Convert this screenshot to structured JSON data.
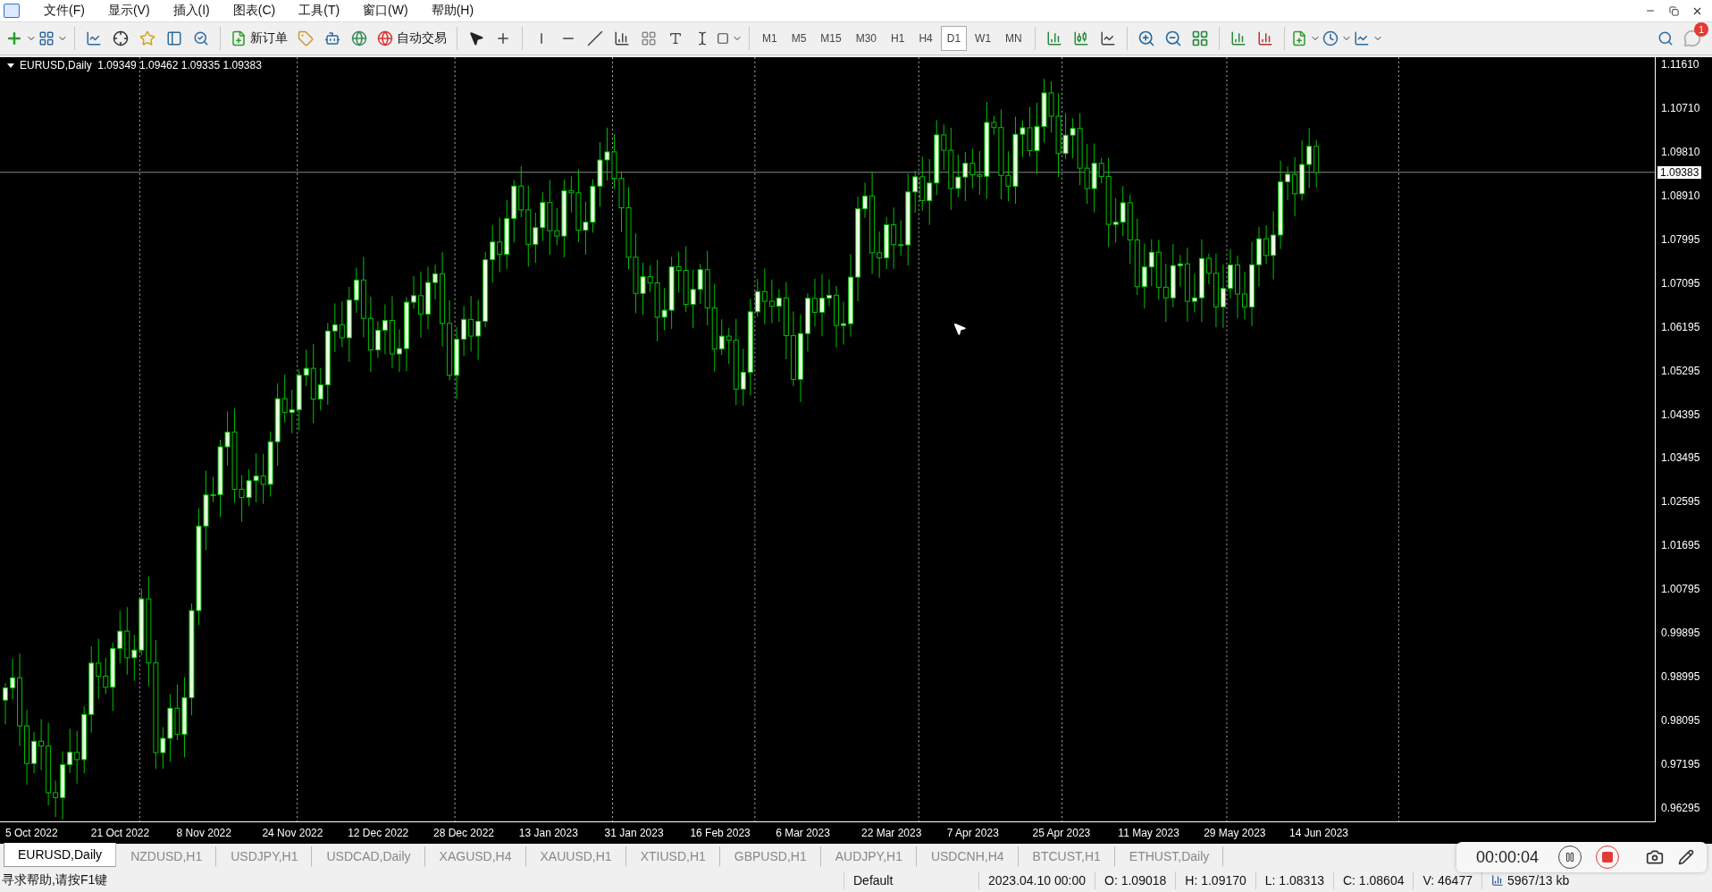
{
  "menu": [
    {
      "label": "文件(F)"
    },
    {
      "label": "显示(V)"
    },
    {
      "label": "插入(I)"
    },
    {
      "label": "图表(C)"
    },
    {
      "label": "工具(T)"
    },
    {
      "label": "窗口(W)"
    },
    {
      "label": "帮助(H)"
    }
  ],
  "toolbar": {
    "new_order": "新订单",
    "auto_trading": "自动交易",
    "timeframes": [
      {
        "label": "M1",
        "selected": false
      },
      {
        "label": "M5",
        "selected": false
      },
      {
        "label": "M15",
        "selected": false
      },
      {
        "label": "M30",
        "selected": false
      },
      {
        "label": "H1",
        "selected": false
      },
      {
        "label": "H4",
        "selected": false
      },
      {
        "label": "D1",
        "selected": true
      },
      {
        "label": "W1",
        "selected": false
      },
      {
        "label": "MN",
        "selected": false
      }
    ],
    "notification_count": "1"
  },
  "chart": {
    "header": "EURUSD,Daily  1.09349 1.09462 1.09335 1.09383",
    "current_price": "1.09383",
    "price_axis": [
      "1.11610",
      "1.10710",
      "1.09810",
      "1.08910",
      "1.07995",
      "1.07095",
      "1.06195",
      "1.05295",
      "1.04395",
      "1.03495",
      "1.02595",
      "1.01695",
      "1.00795",
      "0.99895",
      "0.98995",
      "0.98095",
      "0.97195",
      "0.96295"
    ],
    "date_axis": [
      "5 Oct 2022",
      "21 Oct 2022",
      "8 Nov 2022",
      "24 Nov 2022",
      "12 Dec 2022",
      "28 Dec 2022",
      "13 Jan 2023",
      "31 Jan 2023",
      "16 Feb 2023",
      "6 Mar 2023",
      "22 Mar 2023",
      "7 Apr 2023",
      "25 Apr 2023",
      "11 May 2023",
      "29 May 2023",
      "14 Jun 2023"
    ]
  },
  "tabs": [
    {
      "label": "EURUSD,Daily",
      "selected": true
    },
    {
      "label": "NZDUSD,H1",
      "selected": false
    },
    {
      "label": "USDJPY,H1",
      "selected": false
    },
    {
      "label": "USDCAD,Daily",
      "selected": false
    },
    {
      "label": "XAGUSD,H4",
      "selected": false
    },
    {
      "label": "XAUUSD,H1",
      "selected": false
    },
    {
      "label": "XTIUSD,H1",
      "selected": false
    },
    {
      "label": "GBPUSD,H1",
      "selected": false
    },
    {
      "label": "AUDJPY,H1",
      "selected": false
    },
    {
      "label": "USDCNH,H4",
      "selected": false
    },
    {
      "label": "BTCUST,H1",
      "selected": false
    },
    {
      "label": "ETHUST,Daily",
      "selected": false
    }
  ],
  "recorder": {
    "time": "00:00:04"
  },
  "status_bar": {
    "help": "寻求帮助,请按F1键",
    "fields": [
      "Default",
      "2023.04.10 00:00",
      "O: 1.09018",
      "H: 1.09170",
      "L: 1.08313",
      "C: 1.08604",
      "V: 46477"
    ],
    "traffic": "5967/13 kb"
  }
}
